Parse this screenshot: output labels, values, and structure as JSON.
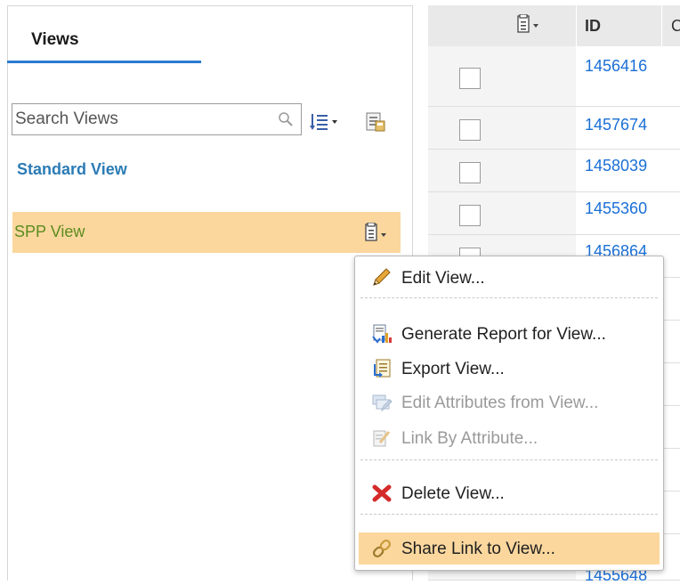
{
  "views_panel": {
    "tab_label": "Views",
    "search_placeholder": "Search Views",
    "views": [
      {
        "label": "Standard View"
      },
      {
        "label": "SPP View"
      }
    ]
  },
  "grid": {
    "header": {
      "id_label": "ID",
      "next_col_label": "C"
    },
    "rows": [
      {
        "id": "1456416"
      },
      {
        "id": "1457674"
      },
      {
        "id": "1458039"
      },
      {
        "id": "1455360"
      },
      {
        "id": "1456864"
      },
      {
        "id": "1455648"
      }
    ]
  },
  "context_menu": {
    "items": [
      {
        "label": "Edit View...",
        "icon": "pencil-icon",
        "enabled": true
      },
      {
        "label": "Generate Report for View...",
        "icon": "report-icon",
        "enabled": true
      },
      {
        "label": "Export View...",
        "icon": "export-icon",
        "enabled": true
      },
      {
        "label": "Edit Attributes from View...",
        "icon": "edit-attributes-icon",
        "enabled": false
      },
      {
        "label": "Link By Attribute...",
        "icon": "link-attribute-icon",
        "enabled": false
      },
      {
        "label": "Delete View...",
        "icon": "red-x-icon",
        "enabled": true
      },
      {
        "label": "Share Link to View...",
        "icon": "chain-link-icon",
        "enabled": true,
        "highlighted": true
      }
    ]
  },
  "colors": {
    "accent_blue": "#2b7bd0",
    "link_blue": "#1a6fd6",
    "selected_row": "#fbd79e",
    "spp_text": "#5b8c1e",
    "delete_red": "#d42a2a"
  }
}
